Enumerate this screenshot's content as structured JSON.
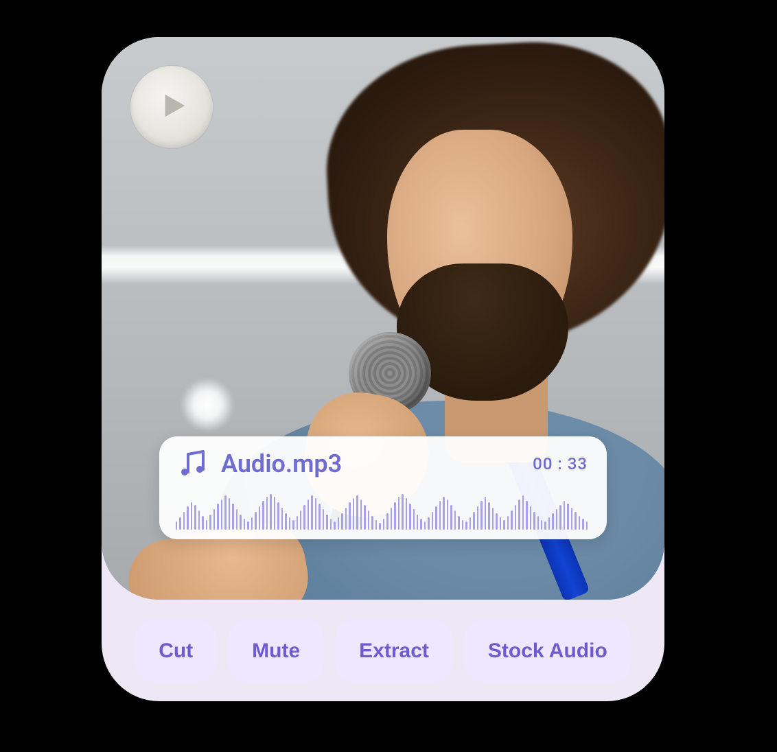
{
  "icons": {
    "play": "play-icon",
    "music": "music-note-icon"
  },
  "audio": {
    "filename": "Audio.mp3",
    "time": "00 : 33",
    "waveform": [
      12,
      18,
      26,
      34,
      40,
      36,
      28,
      20,
      14,
      22,
      30,
      38,
      44,
      50,
      46,
      38,
      30,
      22,
      16,
      12,
      18,
      26,
      34,
      42,
      48,
      52,
      48,
      40,
      32,
      24,
      18,
      14,
      20,
      28,
      36,
      44,
      50,
      46,
      38,
      30,
      22,
      16,
      12,
      18,
      24,
      32,
      40,
      46,
      50,
      44,
      36,
      28,
      20,
      14,
      10,
      16,
      24,
      32,
      40,
      48,
      52,
      46,
      38,
      30,
      22,
      16,
      12,
      18,
      26,
      34,
      42,
      48,
      44,
      36,
      28,
      20,
      14,
      12,
      18,
      26,
      34,
      42,
      48,
      40,
      32,
      24,
      18,
      14,
      20,
      28,
      36,
      44,
      50,
      42,
      34,
      26,
      20,
      14,
      12,
      18,
      24,
      30,
      36,
      42,
      38,
      32,
      26,
      20,
      16,
      12
    ]
  },
  "actions": [
    {
      "id": "cut",
      "label": "Cut"
    },
    {
      "id": "mute",
      "label": "Mute"
    },
    {
      "id": "extract",
      "label": "Extract"
    },
    {
      "id": "stock",
      "label": "Stock Audio"
    }
  ],
  "colors": {
    "accent": "#6c5ccf",
    "pill_bg": "#efe6ff",
    "card_bg": "#ede7f6",
    "wave": "#a9a1e6"
  }
}
